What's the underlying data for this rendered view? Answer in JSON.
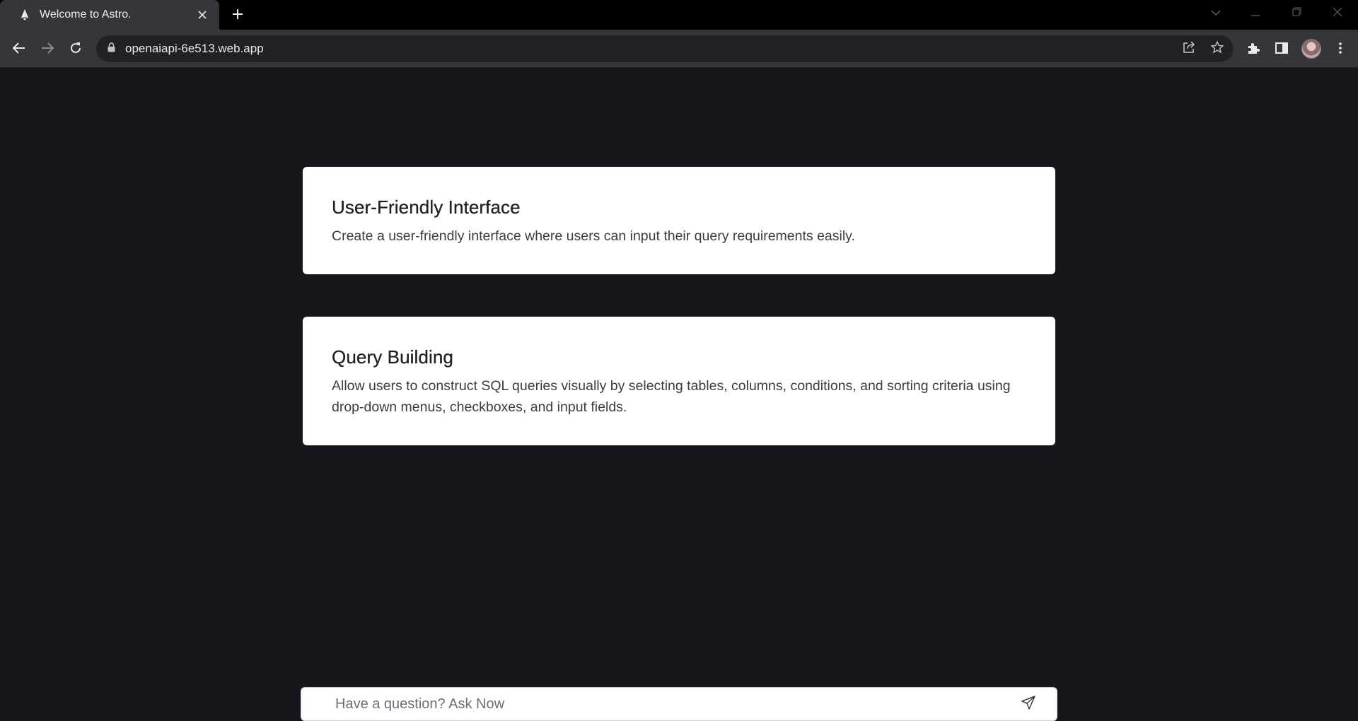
{
  "browser": {
    "tab_title": "Welcome to Astro.",
    "url": "openaiapi-6e513.web.app",
    "icons": {
      "favicon": "astro-logo-icon",
      "tab_close": "close-icon",
      "new_tab": "plus-icon",
      "back": "arrow-left-icon",
      "forward": "arrow-right-icon",
      "reload": "reload-icon",
      "lock": "lock-icon",
      "share": "share-icon",
      "bookmark": "star-icon",
      "extensions": "puzzle-icon",
      "side_panel": "side-panel-icon",
      "profile": "avatar",
      "menu": "kebab-menu-icon"
    }
  },
  "cards": [
    {
      "title": "User-Friendly Interface",
      "description": "Create a user-friendly interface where users can input their query requirements easily."
    },
    {
      "title": "Query Building",
      "description": "Allow users to construct SQL queries visually by selecting tables, columns, conditions, and sorting criteria using drop-down menus, checkboxes, and input fields."
    }
  ],
  "ask": {
    "placeholder": "Have a question? Ask Now",
    "send_icon": "send-icon"
  },
  "colors": {
    "page_background": "#16171c",
    "card_background": "#ffffff",
    "chrome_tabstrip": "#000000",
    "chrome_toolbar": "#35363a"
  }
}
